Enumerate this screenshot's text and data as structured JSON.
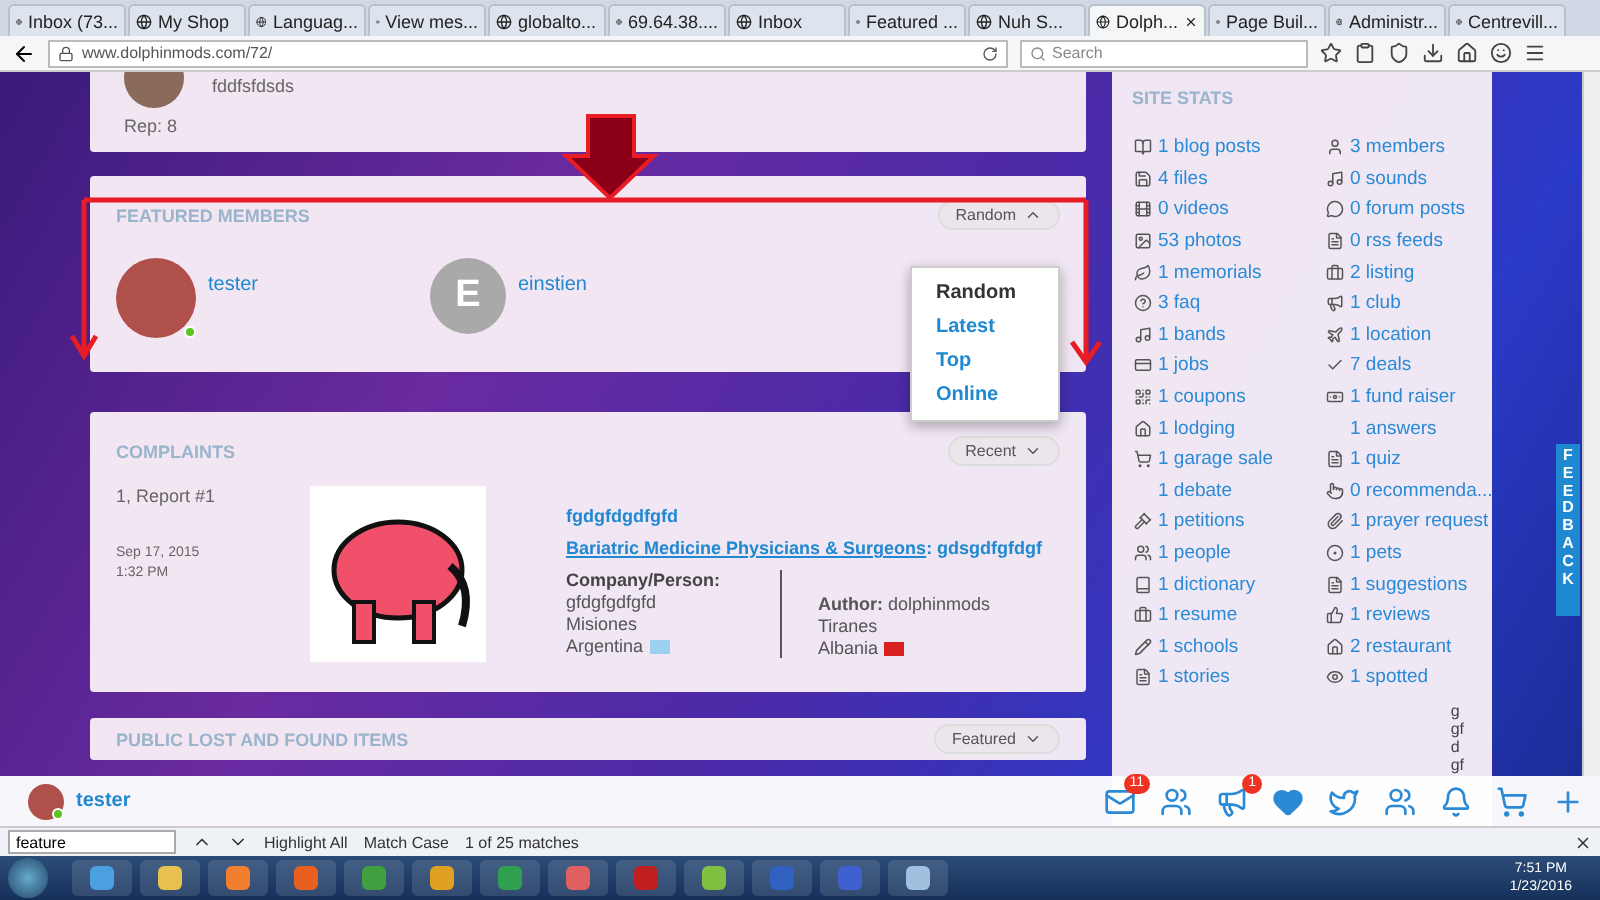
{
  "browser": {
    "tabs": [
      {
        "title": "Inbox (73...",
        "selected": false
      },
      {
        "title": "My Shop",
        "selected": false
      },
      {
        "title": "Languag...",
        "selected": false
      },
      {
        "title": "View mes...",
        "selected": false
      },
      {
        "title": "globalto...",
        "selected": false
      },
      {
        "title": "69.64.38....",
        "selected": false
      },
      {
        "title": "Inbox",
        "selected": false
      },
      {
        "title": "Featured ...",
        "selected": false
      },
      {
        "title": "Nuh S...",
        "selected": false
      },
      {
        "title": "Dolph...",
        "selected": true
      },
      {
        "title": "Page Buil...",
        "selected": false
      },
      {
        "title": "Administr...",
        "selected": false
      },
      {
        "title": "Centrevill...",
        "selected": false
      }
    ],
    "address": "www.dolphinmods.com/72/",
    "search": {
      "placeholder": "Search"
    }
  },
  "profile_card": {
    "text": "fddfsfdsds",
    "rep": "Rep: 8"
  },
  "featured_members": {
    "title": "FEATURED MEMBERS",
    "sort_button": "Random",
    "dropdown_open": true,
    "members": [
      {
        "name": "tester",
        "online": true,
        "kind": "photo"
      },
      {
        "name": "einstien",
        "online": false,
        "kind": "letter",
        "initial": "E"
      }
    ],
    "options": [
      {
        "label": "Random",
        "selected": true
      },
      {
        "label": "Latest",
        "selected": false
      },
      {
        "label": "Top",
        "selected": false
      },
      {
        "label": "Online",
        "selected": false
      }
    ]
  },
  "complaints": {
    "title": "COMPLAINTS",
    "sort_button": "Recent",
    "items": [
      {
        "report": "1, Report #1",
        "date": "Sep 17, 2015",
        "time": "1:32 PM",
        "title": "fgdgfdgdfgfd",
        "category": "Bariatric Medicine Physicians & Surgeons",
        "name": ": gdsgdfgfdgf",
        "company_label": "Company/Person:",
        "company_lines": [
          "gfdgfgdfgfd",
          "Misiones",
          "Argentina"
        ],
        "author": "**Author:** dolphinmods",
        "author_lines": [
          "Tiranes",
          "Albania"
        ]
      }
    ]
  },
  "lost_found": {
    "title": "PUBLIC LOST AND FOUND ITEMS",
    "sort_button": "Featured"
  },
  "site_stats": {
    "title": "SITE STATS",
    "left_column": [
      "1 blog posts",
      "4 files",
      "0 videos",
      "53 photos",
      "1 memorials",
      "3 faq",
      "1 bands",
      "1 jobs",
      "1 coupons",
      "1 lodging",
      "1 garage sale",
      "1 debate",
      "1 petitions",
      "1 people",
      "1 dictionary",
      "1 resume",
      "1 schools",
      "1 stories"
    ],
    "right_column": [
      "3 members",
      "0 sounds",
      "0 forum posts",
      "0 rss feeds",
      "2 listing",
      "1 club",
      "1 location",
      "7 deals",
      "1 fund raiser",
      "1 answers",
      "1 quiz",
      "0 recommenda...",
      "1 prayer request",
      "1 pets",
      "1 suggestions",
      "1 reviews",
      "2 restaurant",
      "1 spotted"
    ],
    "overflow_lines": [
      "g",
      "gf",
      "d",
      "gf"
    ]
  },
  "feedback": "FEEDBACK",
  "member_bar": {
    "user": "tester",
    "online": true,
    "mail_badge": "11",
    "megaphone_badge": "1"
  },
  "find_bar": {
    "value": "feature",
    "highlight_all": "Highlight All",
    "match_case": "Match Case",
    "status": "1 of 25 matches"
  },
  "taskbar": {
    "time": "7:51 PM",
    "date": "1/23/2016"
  }
}
